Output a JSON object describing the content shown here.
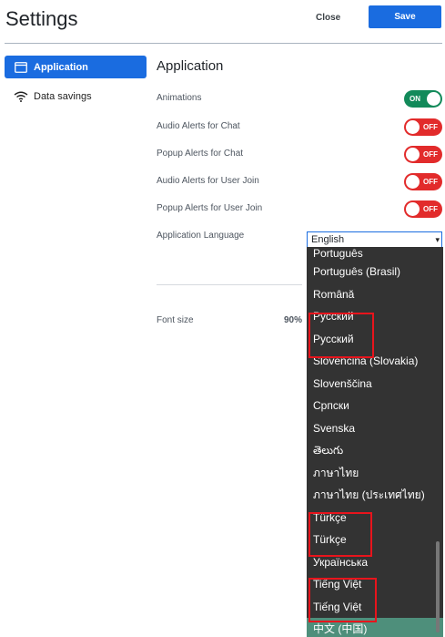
{
  "header": {
    "title": "Settings",
    "close_label": "Close",
    "save_label": "Save"
  },
  "sidebar": {
    "items": [
      {
        "label": "Application",
        "icon": "window-icon",
        "active": true
      },
      {
        "label": "Data savings",
        "icon": "wifi-icon",
        "active": false
      }
    ]
  },
  "main": {
    "section_title": "Application",
    "settings": [
      {
        "label": "Animations",
        "state": "ON"
      },
      {
        "label": "Audio Alerts for Chat",
        "state": "OFF"
      },
      {
        "label": "Popup Alerts for Chat",
        "state": "OFF"
      },
      {
        "label": "Audio Alerts for User Join",
        "state": "OFF"
      },
      {
        "label": "Popup Alerts for User Join",
        "state": "OFF"
      }
    ],
    "language": {
      "label": "Application Language",
      "value": "English"
    },
    "font_size": {
      "label": "Font size",
      "value": "90%"
    }
  },
  "dropdown": {
    "options": [
      "Português",
      "Português (Brasil)",
      "Română",
      "Русский",
      "Русский",
      "Slovenčina (Slovakia)",
      "Slovenščina",
      "Српски",
      "Svenska",
      "తెలుగు",
      "ภาษาไทย",
      "ภาษาไทย (ประเทศไทย)",
      "Türkçe",
      "Türkçe",
      "Українська",
      "Tiếng Việt",
      "Tiếng Việt",
      "中文 (中国)"
    ],
    "selected_option": "中文 (中国)"
  },
  "colors": {
    "accent": "#1a6ce0",
    "toggle_on": "#128a5a",
    "toggle_off": "#e22b2b",
    "dropdown_bg": "#333333",
    "highlight": "#e8141c"
  }
}
